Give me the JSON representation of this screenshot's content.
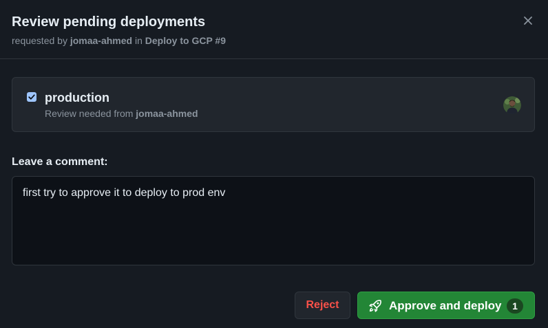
{
  "header": {
    "title": "Review pending deployments",
    "subtitle_prefix": "requested by",
    "requester": "jomaa-ahmed",
    "subtitle_in": "in",
    "workflow_run": "Deploy to GCP #9"
  },
  "environment": {
    "name": "production",
    "checked": true,
    "review_prefix": "Review needed from",
    "reviewer": "jomaa-ahmed"
  },
  "comment": {
    "label": "Leave a comment:",
    "value": "first try to approve it to deploy to prod env"
  },
  "actions": {
    "reject_label": "Reject",
    "approve_label": "Approve and deploy",
    "approve_count": "1"
  },
  "colors": {
    "background": "#161b22",
    "approve": "#238636",
    "reject_text": "#f85149",
    "checkbox": "#9ec5fe"
  },
  "icons": {
    "close": "close-icon",
    "checkbox": "checkmark-icon",
    "approve": "rocket-icon"
  }
}
